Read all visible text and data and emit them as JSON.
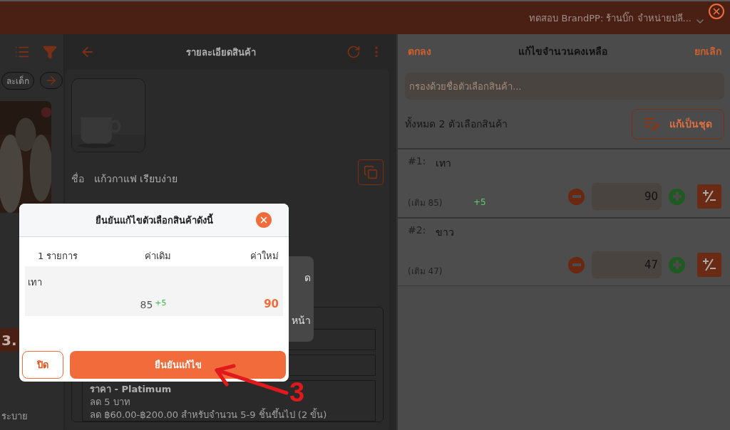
{
  "top_bar": {
    "shop": "ทดสอบ BrandPP: ร้านบิ๊ก จำหน่ายปลี..."
  },
  "list_panel": {
    "chip": "ละเด็ก",
    "badge": "3.",
    "caption": "ระบาย"
  },
  "detail": {
    "title": "รายละเอียดสินค้า",
    "name_label": "ชื่อ",
    "name": "แก้วกาแฟ เรียบง่าย",
    "menu_texts": [
      "ด",
      "หน้า"
    ],
    "price_card": {
      "title": "ราคา - Platimum",
      "lines": [
        "ลด 5 บาท",
        "ลด ฿60.00-฿200.00 สำหรับจำนวน 5-9 ชิ้นขึ้นไป (2 ขั้น)"
      ]
    }
  },
  "stock_editor": {
    "confirm": "ตกลง",
    "title": "แก้ไขจำนวนคงเหลือ",
    "cancel": "ยกเลิก",
    "filter": {
      "placeholder": "กรองด้วยชื่อตัวเลือกสินค้า..."
    },
    "count": "ทั้งหมด 2 ตัวเลือกสินค้า",
    "batch_button": "แก้เป็นชุด",
    "variants": [
      {
        "index": "#1:",
        "name": "เทา",
        "original": "(เดิม 85)",
        "change": "+5",
        "value": "90"
      },
      {
        "index": "#2:",
        "name": "ขาว",
        "original": "(เดิม 47)",
        "value": "47"
      }
    ]
  },
  "dialog": {
    "title": "ยืนยันแก้ไขตัวเลือกสินค้าดังนี้",
    "columns": [
      "1 รายการ",
      "ค่าเดิม",
      "ค่าใหม่"
    ],
    "rows": [
      {
        "name": "เทา",
        "old": "85",
        "change": "+5",
        "new": "90"
      }
    ],
    "close_button": "ปิด",
    "confirm_button": "ยืนยันแก้ไข"
  },
  "annotation": {
    "step": "3"
  }
}
